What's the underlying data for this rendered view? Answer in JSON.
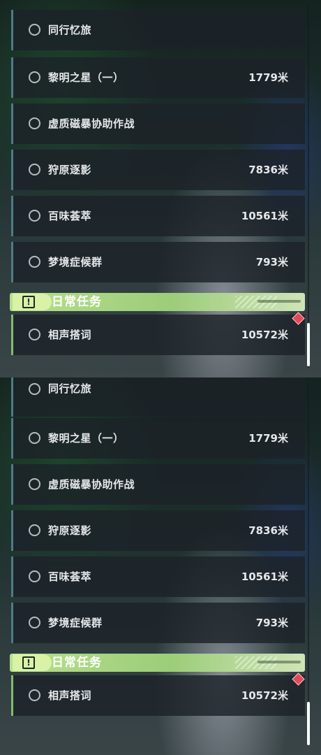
{
  "quests": [
    {
      "name": "同行忆旅",
      "distance": ""
    },
    {
      "name": "黎明之星（一）",
      "distance": "1779米"
    },
    {
      "name": "虚质磁暴协助作战",
      "distance": ""
    },
    {
      "name": "狩原逐影",
      "distance": "7836米"
    },
    {
      "name": "百味荟萃",
      "distance": "10561米"
    },
    {
      "name": "梦境症候群",
      "distance": "793米"
    }
  ],
  "daily_section": {
    "title": "日常任务",
    "badge_icon": "exclamation-square-icon",
    "quests": [
      {
        "name": "相声搭词",
        "distance": "10572米"
      }
    ]
  },
  "colors": {
    "daily_accent": "#9ccd79",
    "quest_accent": "#4e7c86",
    "marker": "#e04b5a"
  }
}
